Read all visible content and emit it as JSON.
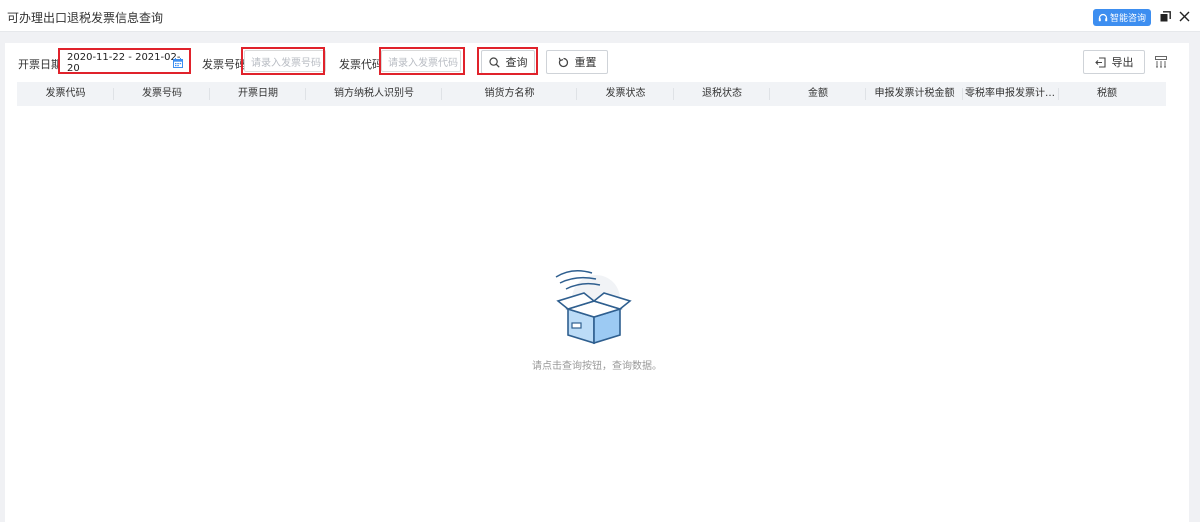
{
  "window": {
    "title": "可办理出口退税发票信息查询",
    "assistant_label": "智能咨询",
    "restore_icon": "window-restore-icon",
    "close_icon": "close-icon"
  },
  "filters": {
    "date_label": "开票日期",
    "date_value": "2020-11-22 - 2021-02-20",
    "invoice_number_label": "发票号码",
    "invoice_number_placeholder": "请录入发票号码",
    "invoice_code_label": "发票代码",
    "invoice_code_placeholder": "请录入发票代码",
    "search_label": "查询",
    "reset_label": "重置",
    "export_label": "导出"
  },
  "table": {
    "columns": [
      "发票代码",
      "发票号码",
      "开票日期",
      "销方纳税人识别号",
      "销货方名称",
      "发票状态",
      "退税状态",
      "金额",
      "申报发票计税金额",
      "零税率申报发票计税...",
      "税额"
    ],
    "rows": []
  },
  "empty_state": {
    "message": "请点击查询按钮，查询数据。"
  },
  "colors": {
    "accent": "#3d8ef0",
    "highlight_border": "#e0222b",
    "header_bg": "#f1f3f6"
  }
}
